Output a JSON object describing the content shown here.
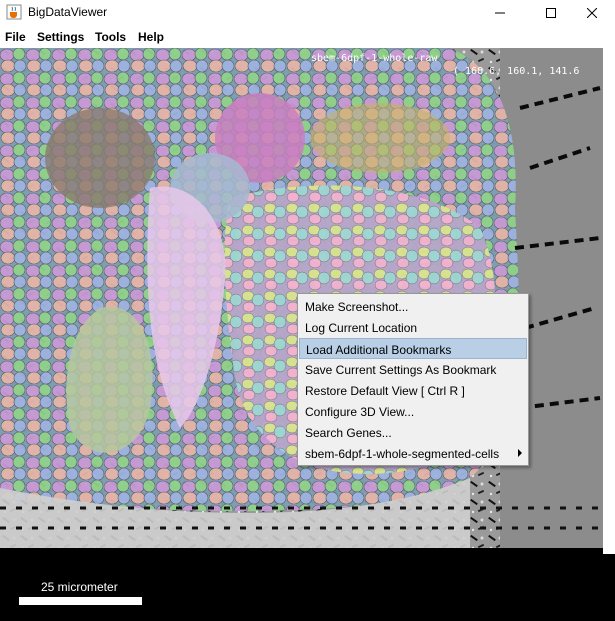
{
  "window": {
    "title": "BigDataViewer",
    "icons": {
      "app": "java-cup-icon",
      "minimize": "minimize-icon",
      "maximize": "maximize-icon",
      "close": "close-icon"
    }
  },
  "menubar": {
    "items": [
      {
        "label": "File"
      },
      {
        "label": "Settings"
      },
      {
        "label": "Tools"
      },
      {
        "label": "Help"
      }
    ]
  },
  "viewer": {
    "source_name": "sbem-6dpf-1-whole-raw",
    "coordinates": "( 168.6, 160.1, 141.6"
  },
  "context_menu": {
    "items": [
      {
        "label": "Make Screenshot..."
      },
      {
        "label": "Log Current Location"
      },
      {
        "label": "Load Additional Bookmarks",
        "highlighted": true
      },
      {
        "label": "Save Current Settings As Bookmark"
      },
      {
        "label": "Restore Default View [ Ctrl R ]"
      },
      {
        "label": "Configure 3D View..."
      },
      {
        "label": "Search Genes..."
      },
      {
        "label": "sbem-6dpf-1-whole-segmented-cells",
        "submenu": true
      }
    ]
  },
  "scale_bar": {
    "label": "25 micrometer"
  },
  "colors": {
    "highlight": "#b8cfe5",
    "menu_bg": "#f0f0f0"
  }
}
